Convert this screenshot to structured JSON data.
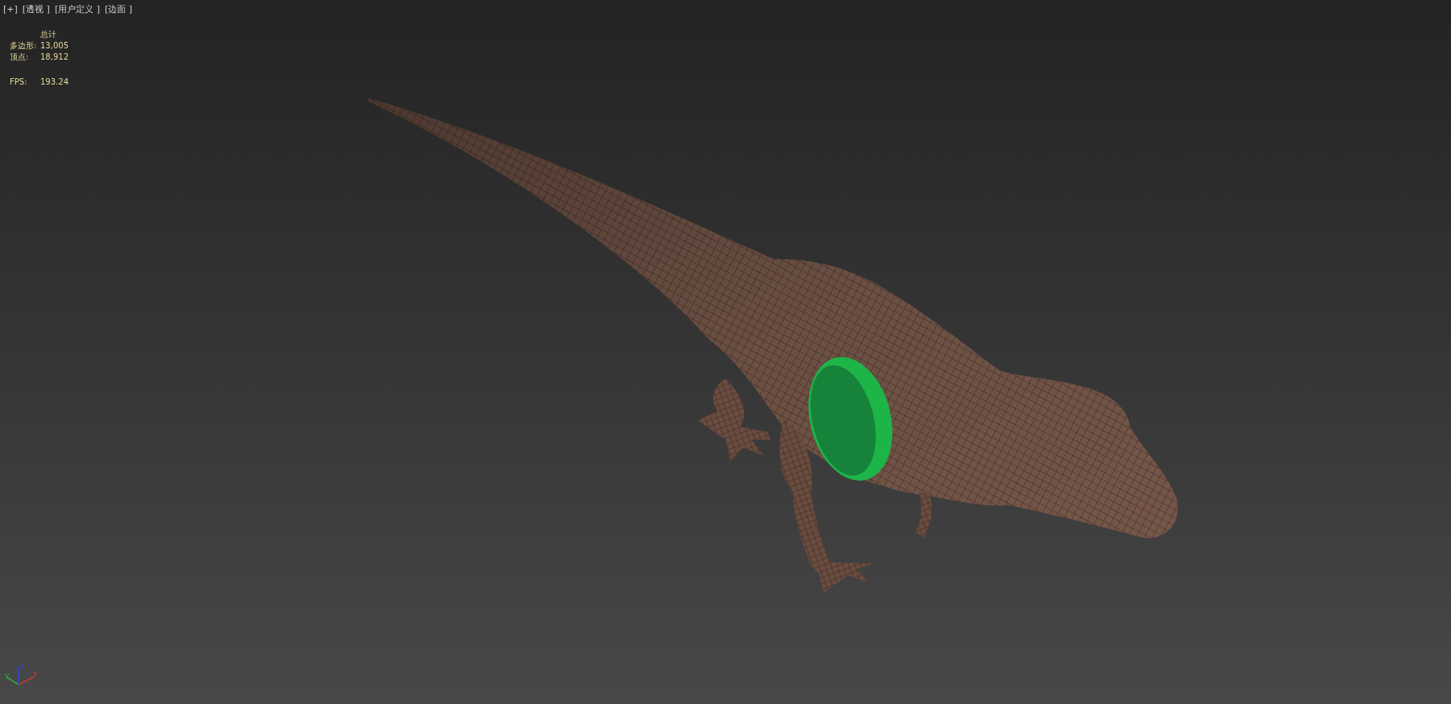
{
  "viewport": {
    "menus": [
      {
        "text": "[+]"
      },
      {
        "text": "[透视 ]"
      },
      {
        "text": "[用户定义 ]"
      },
      {
        "text": "[边面 ]"
      }
    ],
    "stats": {
      "heading": "总计",
      "rows": [
        {
          "label": "多边形:",
          "value": "13,005"
        },
        {
          "label": "顶点:",
          "value": "18,912"
        }
      ],
      "fps": {
        "label": "FPS:",
        "value": "193.24"
      }
    },
    "axis_gizmo": {
      "labels": [
        {
          "text": "x"
        },
        {
          "text": "y"
        },
        {
          "text": "z"
        }
      ]
    }
  }
}
